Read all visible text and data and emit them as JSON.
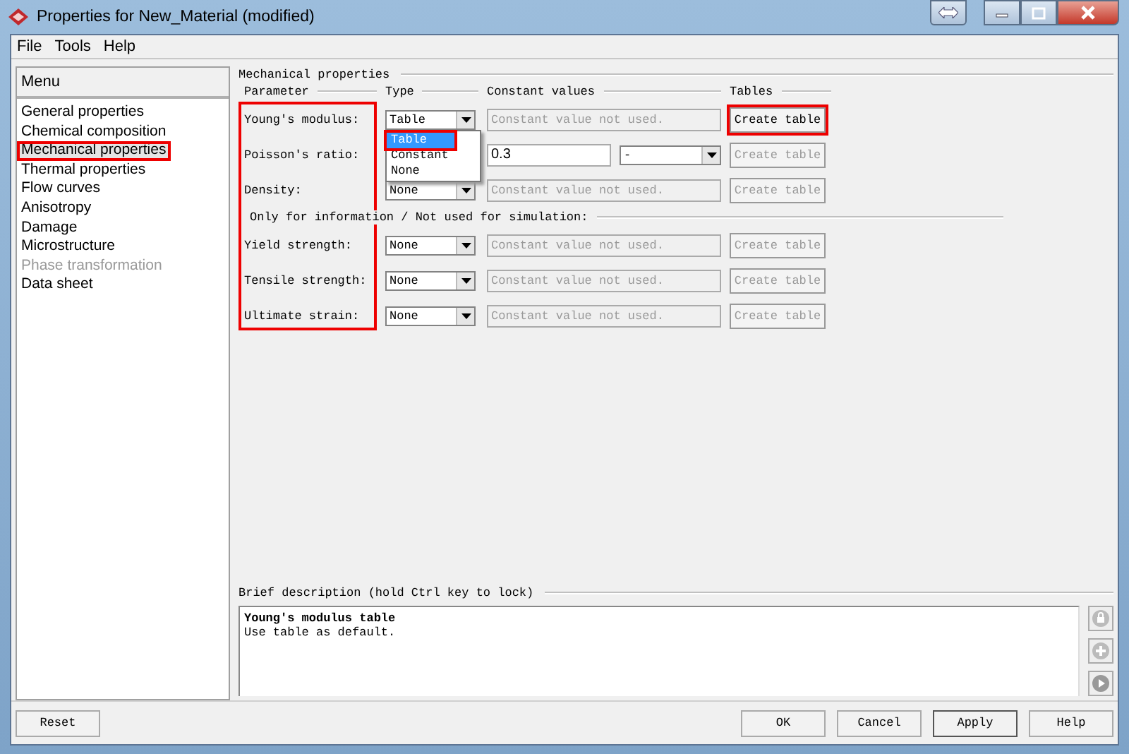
{
  "window": {
    "title": "Properties for New_Material (modified)"
  },
  "menubar": [
    "File",
    "Tools",
    "Help"
  ],
  "sidebar": {
    "header": "Menu",
    "items": [
      {
        "label": "General properties",
        "selected": false,
        "disabled": false,
        "highlighted": false
      },
      {
        "label": "Chemical composition",
        "selected": false,
        "disabled": false,
        "highlighted": false
      },
      {
        "label": "Mechanical properties",
        "selected": true,
        "disabled": false,
        "highlighted": true
      },
      {
        "label": "Thermal properties",
        "selected": false,
        "disabled": false,
        "highlighted": false
      },
      {
        "label": "Flow curves",
        "selected": false,
        "disabled": false,
        "highlighted": false
      },
      {
        "label": "Anisotropy",
        "selected": false,
        "disabled": false,
        "highlighted": false
      },
      {
        "label": "Damage",
        "selected": false,
        "disabled": false,
        "highlighted": false
      },
      {
        "label": "Microstructure",
        "selected": false,
        "disabled": false,
        "highlighted": false
      },
      {
        "label": "Phase transformation",
        "selected": false,
        "disabled": true,
        "highlighted": false
      },
      {
        "label": "Data sheet",
        "selected": false,
        "disabled": false,
        "highlighted": false
      }
    ]
  },
  "mechanical": {
    "title": "Mechanical properties",
    "columns": [
      "Parameter",
      "Type",
      "Constant values",
      "Tables"
    ],
    "labels_highlighted": true,
    "rows": [
      {
        "kind": "param",
        "label": "Young's modulus:",
        "type": "Table",
        "placeholder": "Constant value not used.",
        "value_enabled": false,
        "table_button": "Create table",
        "table_enabled": true,
        "highlighted": true
      },
      {
        "kind": "param",
        "label": "Poisson's ratio:",
        "value": "0.3",
        "value_enabled": true,
        "unit": "-",
        "table_button": "Create table",
        "table_enabled": false,
        "highlighted": false
      },
      {
        "kind": "param",
        "label": "Density:",
        "type": "None",
        "placeholder": "Constant value not used.",
        "value_enabled": false,
        "table_button": "Create table",
        "table_enabled": false,
        "highlighted": false
      },
      {
        "kind": "heading",
        "label": "Only for information / Not used for simulation:"
      },
      {
        "kind": "param",
        "label": "Yield strength:",
        "type": "None",
        "placeholder": "Constant value not used.",
        "value_enabled": false,
        "table_button": "Create table",
        "table_enabled": false,
        "highlighted": false
      },
      {
        "kind": "param",
        "label": "Tensile strength:",
        "type": "None",
        "placeholder": "Constant value not used.",
        "value_enabled": false,
        "table_button": "Create table",
        "table_enabled": false,
        "highlighted": false
      },
      {
        "kind": "param",
        "label": "Ultimate strain:",
        "type": "None",
        "placeholder": "Constant value not used.",
        "value_enabled": false,
        "table_button": "Create table",
        "table_enabled": false,
        "highlighted": false
      }
    ],
    "dropdown": {
      "options": [
        {
          "label": "Table",
          "selected": true,
          "highlighted": true
        },
        {
          "label": "Constant",
          "selected": false,
          "highlighted": false
        },
        {
          "label": "None",
          "selected": false,
          "highlighted": false
        }
      ]
    }
  },
  "description": {
    "title": "Brief description (hold Ctrl key to lock)",
    "heading": "Young's modulus table",
    "text": "Use table as default."
  },
  "buttons": {
    "left": "Reset",
    "right": [
      "OK",
      "Cancel",
      "Apply",
      "Help"
    ]
  }
}
